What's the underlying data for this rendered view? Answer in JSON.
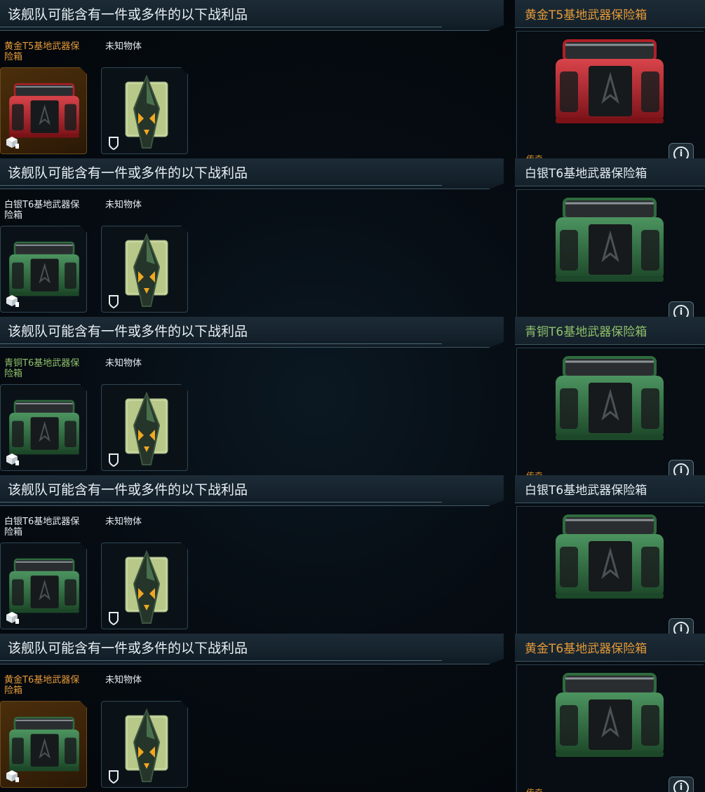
{
  "colors": {
    "gold": "#e59a38",
    "silver": "#e6edf2",
    "bronze": "#8fc06a",
    "white": "#e6edf2"
  },
  "panels": [
    {
      "header": "该舰队可能含有一件或多件的以下战利品",
      "crate_label": "黄金T5基地武器保险箱",
      "crate_color": "gold",
      "crate_variant": "red",
      "unknown_label": "未知物体",
      "preview_title": "黄金T5基地武器保险箱",
      "rarity": "传奇",
      "info_icon": "info-icon",
      "info_glyph": "i"
    },
    {
      "header": "该舰队可能含有一件或多件的以下战利品",
      "crate_label": "白银T6基地武器保险箱",
      "crate_color": "silver",
      "crate_variant": "green",
      "unknown_label": "未知物体",
      "preview_title": "白银T6基地武器保险箱",
      "rarity": "",
      "info_icon": "info-icon",
      "info_glyph": "i"
    },
    {
      "header": "该舰队可能含有一件或多件的以下战利品",
      "crate_label": "青铜T6基地武器保险箱",
      "crate_color": "bronze",
      "crate_variant": "green",
      "unknown_label": "未知物体",
      "preview_title": "青铜T6基地武器保险箱",
      "rarity": "传奇",
      "info_icon": "info-icon",
      "info_glyph": "i"
    },
    {
      "header": "该舰队可能含有一件或多件的以下战利品",
      "crate_label": "白银T6基地武器保险箱",
      "crate_color": "silver",
      "crate_variant": "green",
      "unknown_label": "未知物体",
      "preview_title": "白银T6基地武器保险箱",
      "rarity": "",
      "info_icon": "info-icon",
      "info_glyph": "i"
    },
    {
      "header": "该舰队可能含有一件或多件的以下战利品",
      "crate_label": "黄金T6基地武器保险箱",
      "crate_color": "gold",
      "crate_variant": "green",
      "unknown_label": "未知物体",
      "preview_title": "黄金T6基地武器保险箱",
      "rarity": "传奇",
      "info_icon": "info-icon",
      "info_glyph": "i"
    }
  ]
}
